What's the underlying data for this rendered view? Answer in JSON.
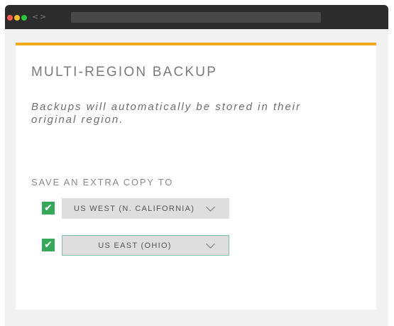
{
  "window": {
    "controls": [
      "close",
      "minimize",
      "maximize"
    ],
    "nav": {
      "back": "<",
      "forward": ">"
    }
  },
  "card": {
    "accent_color": "#f0a81c",
    "title": "MULTI-REGION BACKUP",
    "description": "Backups will automatically be stored in their original region.",
    "section_label": "SAVE AN EXTRA COPY TO",
    "regions": [
      {
        "checked": true,
        "check_icon": "checkmark-icon",
        "check_glyph": "✔",
        "label": "US WEST (N. CALIFORNIA)",
        "dropdown_icon": "chevron-down-icon"
      },
      {
        "checked": true,
        "check_icon": "checkmark-icon",
        "check_glyph": "✔",
        "label": "US EAST (OHIO)",
        "dropdown_icon": "chevron-down-icon"
      }
    ]
  },
  "colors": {
    "checkbox": "#36a85a",
    "focus_border": "#7ec4a7",
    "titlebar": "#2c2c2c"
  }
}
